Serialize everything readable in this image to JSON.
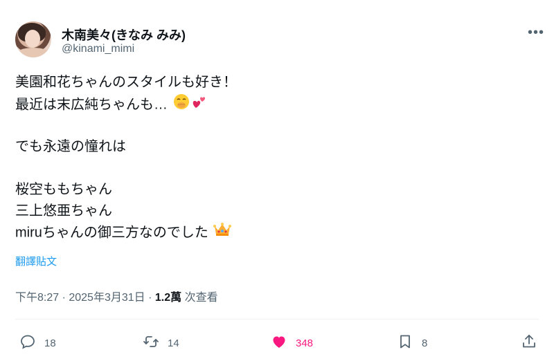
{
  "author": {
    "display_name": "木南美々(きなみ みみ)",
    "handle": "@kinami_mimi"
  },
  "tweet": {
    "lines": [
      "美園和花ちゃんのスタイルも好き！",
      "最近は末広純ちゃんも…",
      "でも永遠の憧れは",
      "桜空ももちゃん",
      "三上悠亜ちゃん",
      "miruちゃんの御三方なのでした"
    ],
    "emojis": [
      "hand-over-mouth-emoji",
      "two-hearts-emoji",
      "crown-emoji"
    ]
  },
  "translate_label": "翻譯貼文",
  "meta": {
    "time": "下午8:27 · 2025年3月31日 · ",
    "views_count": "1.2萬",
    "views_label": " 次查看"
  },
  "actions": {
    "replies": "18",
    "reposts": "14",
    "likes": "348",
    "bookmarks": "8"
  },
  "colors": {
    "accent": "#1d9bf0",
    "like": "#f91880",
    "secondary_text": "#536471"
  }
}
